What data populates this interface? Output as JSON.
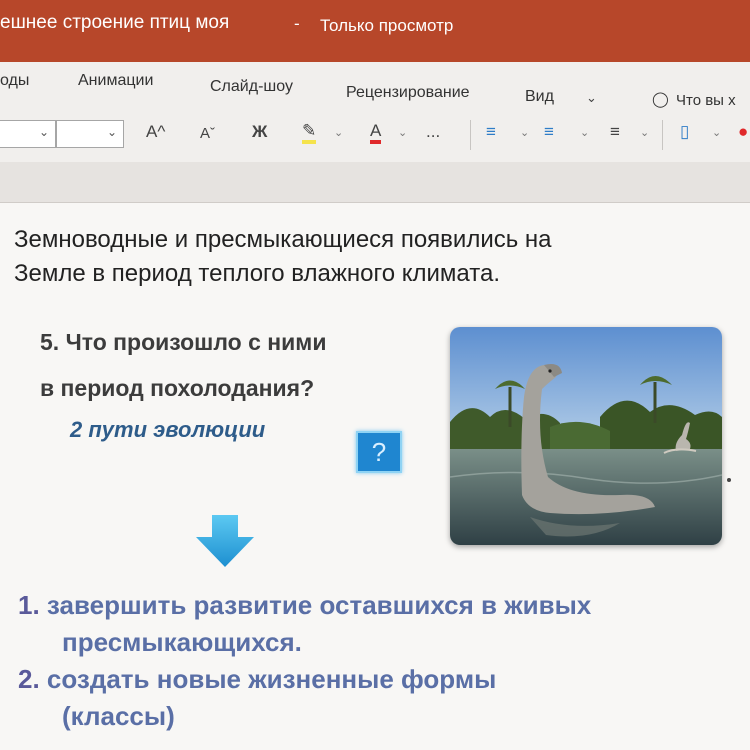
{
  "titlebar": {
    "title": "ешнее строение птиц моя",
    "separator": "-",
    "mode": "Только просмотр",
    "accent": "#b7472a"
  },
  "tabs": {
    "items": [
      "оды",
      "Анимации",
      "Слайд-шоу",
      "Рецензирование",
      "Вид"
    ],
    "tell_me": "Что вы х"
  },
  "toolbar": {
    "grow_font": "A^",
    "shrink_font": "Aˇ",
    "bold": "Ж",
    "font_color": "A",
    "more": "...",
    "highlight_color": "#f5e34c",
    "font_color_value": "#e0292b"
  },
  "slide": {
    "intro_line1": "Земноводные и пресмыкающиеся появились на",
    "intro_line2": "Земле в период теплого влажного климата.",
    "question_line1": "5. Что произошло с ними",
    "question_line2": "в период  похолодания?",
    "paths": "2 пути эволюции",
    "qmark": "?",
    "answers": [
      {
        "num": "1.",
        "line1": "завершить развитие оставшихся в живых",
        "line2": "пресмыкающихся."
      },
      {
        "num": "2.",
        "line1": "создать новые жизненные формы",
        "line2": "(классы)"
      }
    ]
  }
}
